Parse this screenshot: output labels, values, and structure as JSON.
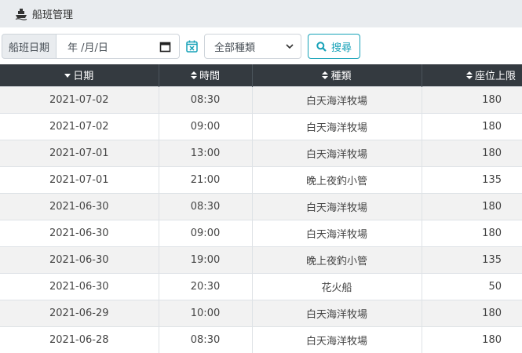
{
  "header": {
    "title": "船班管理",
    "icon": "ship-icon"
  },
  "filters": {
    "date_label": "船班日期",
    "date_value": "年 /月/日",
    "type_selected": "全部種類",
    "search_label": "搜尋",
    "accent_color": "#17a2b8"
  },
  "table": {
    "columns": [
      "日期",
      "時間",
      "種類",
      "座位上限"
    ],
    "rows": [
      [
        "2021-07-02",
        "08:30",
        "白天海洋牧場",
        "180"
      ],
      [
        "2021-07-02",
        "09:00",
        "白天海洋牧場",
        "180"
      ],
      [
        "2021-07-01",
        "13:00",
        "白天海洋牧場",
        "180"
      ],
      [
        "2021-07-01",
        "21:00",
        "晚上夜釣小管",
        "135"
      ],
      [
        "2021-06-30",
        "08:30",
        "白天海洋牧場",
        "180"
      ],
      [
        "2021-06-30",
        "09:00",
        "白天海洋牧場",
        "180"
      ],
      [
        "2021-06-30",
        "19:00",
        "晚上夜釣小管",
        "135"
      ],
      [
        "2021-06-30",
        "20:30",
        "花火船",
        "50"
      ],
      [
        "2021-06-29",
        "10:00",
        "白天海洋牧場",
        "180"
      ],
      [
        "2021-06-28",
        "08:30",
        "白天海洋牧場",
        "180"
      ]
    ]
  }
}
